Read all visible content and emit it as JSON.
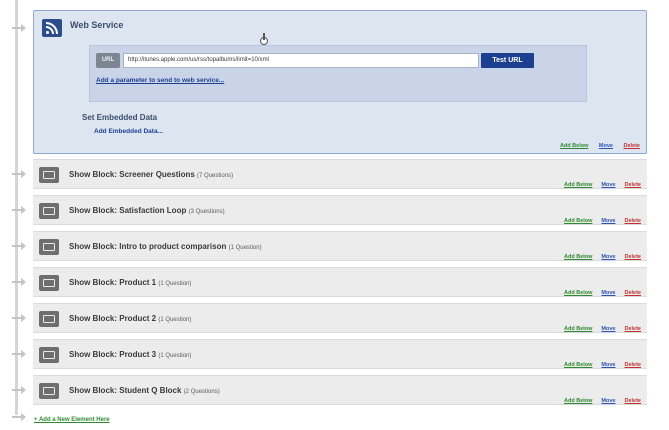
{
  "web_service": {
    "title": "Web Service",
    "url_tag": "URL",
    "url_value": "http://itunes.apple.com/us/rss/topalbums/limit=10/xml",
    "test_url_label": "Test URL",
    "add_parameter_link": "Add a parameter to send to web service...",
    "embedded_title": "Set Embedded Data",
    "embedded_link": "Add Embedded Data..."
  },
  "actions": {
    "add_below": "Add Below",
    "move": "Move",
    "delete": "Delete"
  },
  "blocks": [
    {
      "name": "Show Block: Screener Questions",
      "count": "(7 Questions)"
    },
    {
      "name": "Show Block: Satisfaction Loop",
      "count": "(3 Questions)"
    },
    {
      "name": "Show Block: Intro to product comparison",
      "count": "(1 Question)"
    },
    {
      "name": "Show Block: Product 1",
      "count": "(1 Question)"
    },
    {
      "name": "Show Block: Product 2",
      "count": "(1 Question)"
    },
    {
      "name": "Show Block: Product 3",
      "count": "(1 Question)"
    },
    {
      "name": "Show Block: Student Q Block",
      "count": "(2 Questions)"
    }
  ],
  "footer": {
    "add_element_link": "+ Add a New Element Here"
  },
  "colors": {
    "accent": "#1d3f8f",
    "add_below": "#2f8a2f",
    "move": "#2a52b8",
    "delete": "#c23131"
  }
}
